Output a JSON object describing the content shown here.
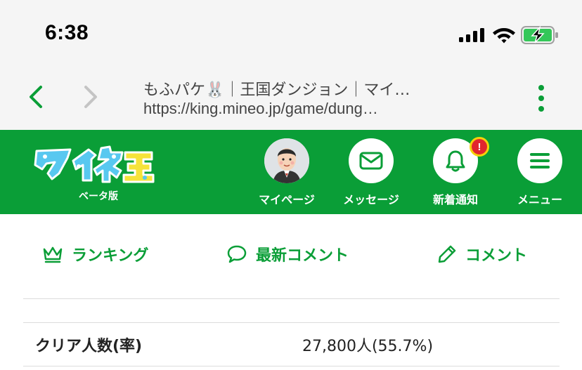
{
  "status_bar": {
    "time": "6:38"
  },
  "browser": {
    "title": "もふパケ🐰｜王国ダンジョン｜マイ…",
    "url": "https://king.mineo.jp/game/dung…"
  },
  "header": {
    "logo_text": "マイネ王",
    "logo_sub": "ベータ版",
    "mypage_label": "マイページ",
    "message_label": "メッセージ",
    "notification_label": "新着通知",
    "notification_badge": "!",
    "menu_label": "メニュー"
  },
  "tabs": {
    "ranking": "ランキング",
    "latest_comments": "最新コメント",
    "comment": "コメント"
  },
  "table": {
    "rows": [
      {
        "label": "クリア人数(率)",
        "value": "27,800人(55.7%)"
      }
    ]
  },
  "colors": {
    "brand_green": "#0a9e37",
    "badge_red": "#e1252e",
    "badge_ring": "#f5d20a",
    "battery_green": "#34c759"
  }
}
